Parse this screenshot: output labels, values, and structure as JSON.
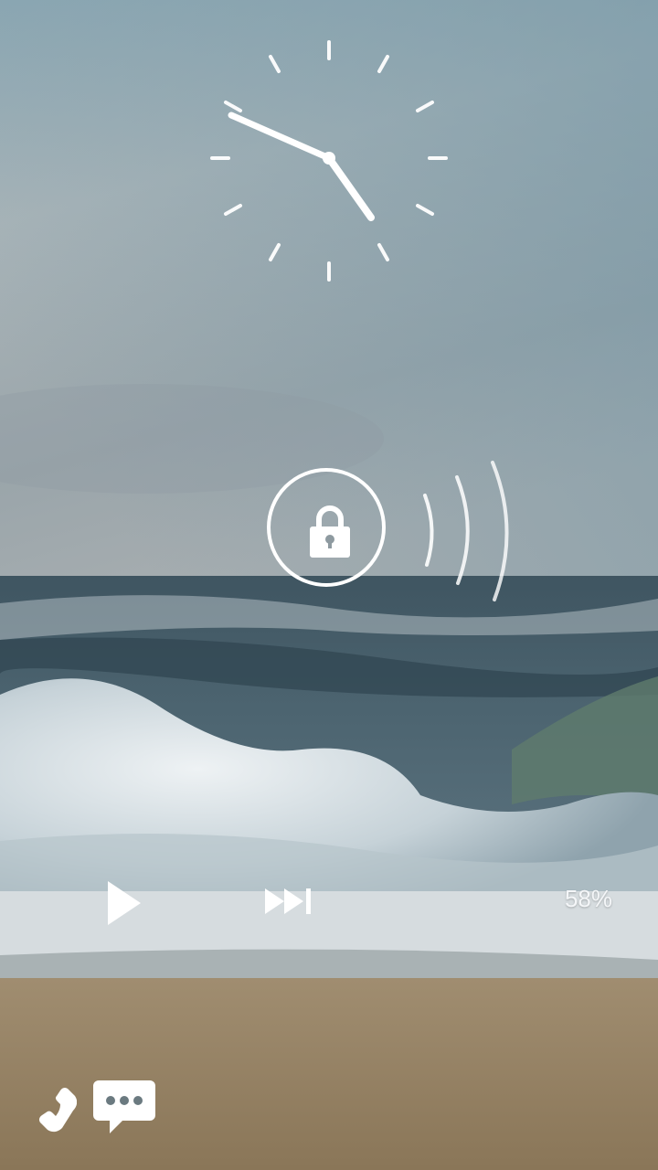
{
  "lockscreen": {
    "clock": {
      "hour_hand_angle_deg": 146,
      "minute_hand_angle_deg": 293
    },
    "battery": {
      "percent_text": "58%"
    },
    "icons": {
      "lock": "lock-icon",
      "play": "play-icon",
      "skip_next": "skip-next-icon",
      "phone": "phone-icon",
      "message": "message-icon"
    },
    "colors": {
      "foreground": "#ffffff"
    }
  }
}
